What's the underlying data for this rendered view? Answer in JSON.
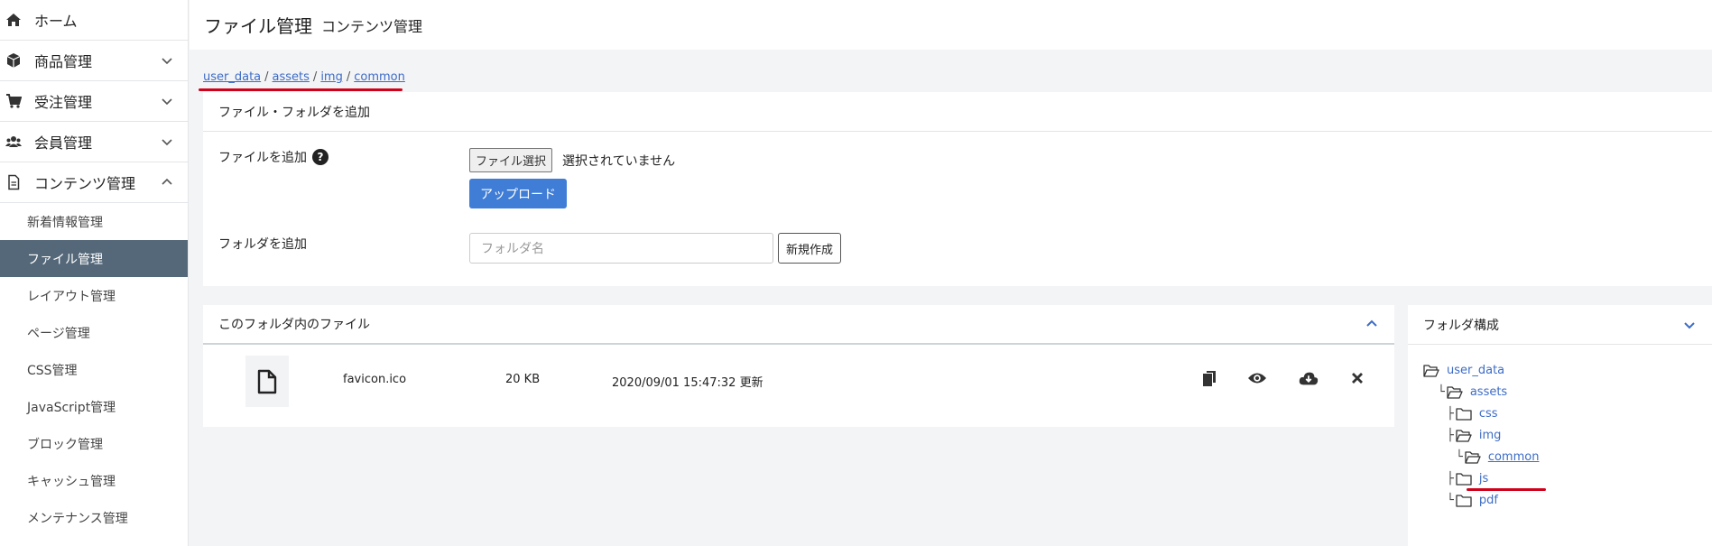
{
  "sidebar": {
    "home": {
      "label": "ホーム"
    },
    "items": [
      {
        "label": "商品管理"
      },
      {
        "label": "受注管理"
      },
      {
        "label": "会員管理"
      },
      {
        "label": "コンテンツ管理"
      }
    ],
    "sub_items": [
      {
        "label": "新着情報管理"
      },
      {
        "label": "ファイル管理"
      },
      {
        "label": "レイアウト管理"
      },
      {
        "label": "ページ管理"
      },
      {
        "label": "CSS管理"
      },
      {
        "label": "JavaScript管理"
      },
      {
        "label": "ブロック管理"
      },
      {
        "label": "キャッシュ管理"
      },
      {
        "label": "メンテナンス管理"
      }
    ],
    "active_sub_item": "ファイル管理"
  },
  "header": {
    "title": "ファイル管理",
    "subtitle": "コンテンツ管理"
  },
  "breadcrumb": [
    "user_data",
    "assets",
    "img",
    "common"
  ],
  "breadcrumb_sep": "/",
  "add_panel": {
    "title": "ファイル・フォルダを追加",
    "file_label": "ファイルを追加",
    "help_glyph": "?",
    "file_button": "ファイル選択",
    "file_status": "選択されていません",
    "upload_button": "アップロード",
    "folder_label": "フォルダを追加",
    "folder_placeholder": "フォルダ名",
    "create_button": "新規作成"
  },
  "files_panel": {
    "title": "このフォルダ内のファイル",
    "files": [
      {
        "name": "favicon.ico",
        "size": "20 KB",
        "date": "2020/09/01 15:47:32 更新"
      }
    ]
  },
  "tree_panel": {
    "title": "フォルダ構成",
    "items": [
      {
        "label": "user_data",
        "branch": "",
        "icon": "folder-open-icon"
      },
      {
        "label": "assets",
        "branch": "└",
        "icon": "folder-open-icon"
      },
      {
        "label": "css",
        "branch": "├",
        "icon": "folder-icon"
      },
      {
        "label": "img",
        "branch": "├",
        "icon": "folder-open-icon"
      },
      {
        "label": "common",
        "branch": "└",
        "icon": "folder-open-icon",
        "current": true
      },
      {
        "label": "js",
        "branch": "├",
        "icon": "folder-icon"
      },
      {
        "label": "pdf",
        "branch": "└",
        "icon": "folder-icon"
      }
    ]
  },
  "colors": {
    "accent": "#3f7dd6",
    "link": "#3d6cc6",
    "active_nav_bg": "#54687a",
    "highlight_red": "#d0021b",
    "page_bg": "#f3f4f6"
  }
}
